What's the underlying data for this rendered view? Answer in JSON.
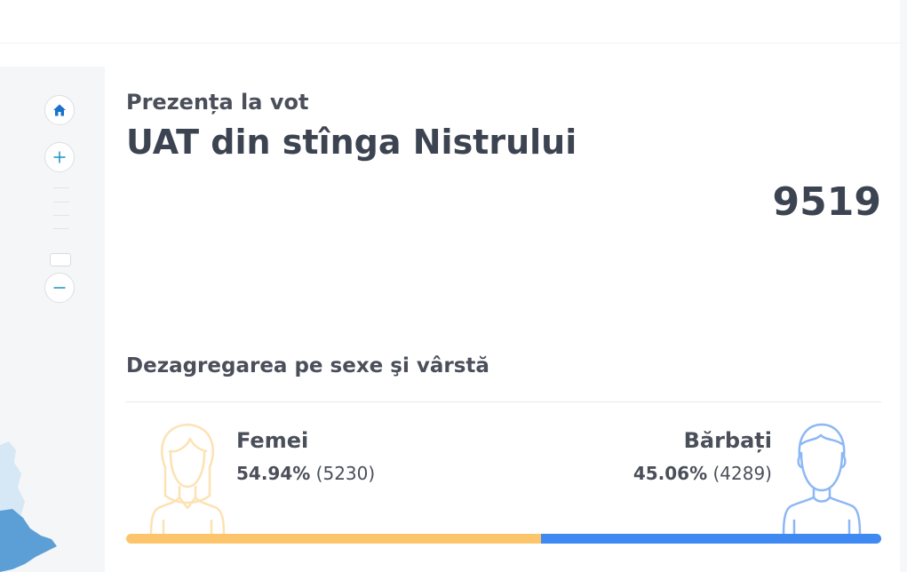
{
  "header": {
    "subtitle": "Prezența la vot",
    "title": "UAT din stînga Nistrului",
    "total": "9519"
  },
  "breakdown": {
    "section_title": "Dezagregarea pe sexe şi vârstă",
    "female": {
      "label": "Femei",
      "percent": "54.94%",
      "count": "(5230)",
      "share": 0.5494,
      "color": "#fdc56b",
      "icon": "female-figure-icon"
    },
    "male": {
      "label": "Bărbați",
      "percent": "45.06%",
      "count": "(4289)",
      "share": 0.4506,
      "color": "#3e8af2",
      "icon": "male-figure-icon"
    }
  },
  "map": {
    "controls": {
      "home_icon": "home-icon",
      "zoom_in_icon": "plus-icon",
      "zoom_out_icon": "minus-icon"
    },
    "colors": {
      "region_light": "#cfe4f3",
      "region_dark": "#5a9fd6"
    }
  }
}
